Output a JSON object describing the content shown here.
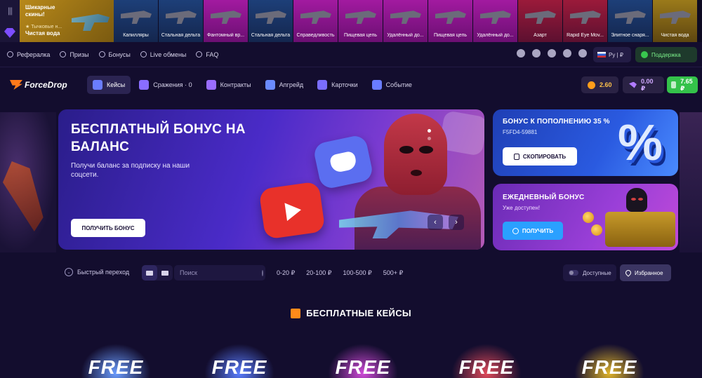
{
  "drops": {
    "featured": {
      "title": "Шикарные скины!",
      "sub": "★ Тычковые н...",
      "item": "Чистая вода"
    },
    "items": [
      {
        "label": "Капилляры",
        "tone": "c-blue"
      },
      {
        "label": "Стальная дельта",
        "tone": "c-blue"
      },
      {
        "label": "Фантомный вр...",
        "tone": "c-pink"
      },
      {
        "label": "Стальная дельта",
        "tone": "c-blue"
      },
      {
        "label": "Справедливость",
        "tone": "c-pink"
      },
      {
        "label": "Пищевая цепь",
        "tone": "c-pink"
      },
      {
        "label": "Удалённый до...",
        "tone": "c-pink"
      },
      {
        "label": "Пищевая цепь",
        "tone": "c-pink"
      },
      {
        "label": "Удалённый до...",
        "tone": "c-pink"
      },
      {
        "label": "Азарт",
        "tone": "c-red"
      },
      {
        "label": "Rapid Eye Mov...",
        "tone": "c-red"
      },
      {
        "label": "Элитное снаря...",
        "tone": "c-blue"
      },
      {
        "label": "Чистая вода",
        "tone": "c-gold"
      }
    ]
  },
  "topbar": {
    "links": [
      "Рефералка",
      "Призы",
      "Бонусы",
      "Live обмены",
      "FAQ"
    ],
    "lang": "Ру | ₽",
    "support": "Поддержка"
  },
  "nav": {
    "logo": "ForceDrop",
    "items": [
      {
        "label": "Кейсы",
        "icon": "cases-icon",
        "color": "#6a7dff"
      },
      {
        "label": "Сражения · 0",
        "icon": "battles-icon",
        "color": "#8a6dff"
      },
      {
        "label": "Контракты",
        "icon": "contracts-icon",
        "color": "#9a6dff"
      },
      {
        "label": "Апгрейд",
        "icon": "upgrade-icon",
        "color": "#6a8aff"
      },
      {
        "label": "Карточки",
        "icon": "cards-icon",
        "color": "#7a6dff"
      },
      {
        "label": "Событие",
        "icon": "event-icon",
        "color": "#6a7dff"
      }
    ],
    "coins": "2.60",
    "gems": "0.00 ₽",
    "balance": "7.65 ₽"
  },
  "hero": {
    "title": "БЕСПЛАТНЫЙ БОНУС НА БАЛАНС",
    "subtitle": "Получи баланс за подписку на наши соцсети.",
    "button": "ПОЛУЧИТЬ БОНУС",
    "prev": "‹",
    "next": "›"
  },
  "promo": {
    "title": "БОНУС К ПОПОЛНЕНИЮ 35 %",
    "code": "F5FD4-59881",
    "button": "СКОПИРОВАТЬ",
    "percent_sign": "%"
  },
  "daily": {
    "title": "ЕЖЕДНЕВНЫЙ БОНУС",
    "subtitle": "Уже доступен!",
    "button": "ПОЛУЧИТЬ"
  },
  "filters": {
    "quick_jump": "Быстрый переход",
    "search_placeholder": "Поиск",
    "price_ranges": [
      "0-20 ₽",
      "20-100 ₽",
      "100-500 ₽",
      "500+ ₽"
    ],
    "available": "Доступные",
    "favorites": "Избранное"
  },
  "free_cases": {
    "title": "БЕСПЛАТНЫЕ КЕЙСЫ",
    "cases": [
      {
        "label": "FREE",
        "color": "#6a9cff"
      },
      {
        "label": "FREE",
        "color": "#5a7dff"
      },
      {
        "label": "FREE",
        "color": "#d04ad8"
      },
      {
        "label": "FREE",
        "color": "#e04a5a"
      },
      {
        "label": "FREE",
        "color": "#e0b42a"
      }
    ]
  }
}
